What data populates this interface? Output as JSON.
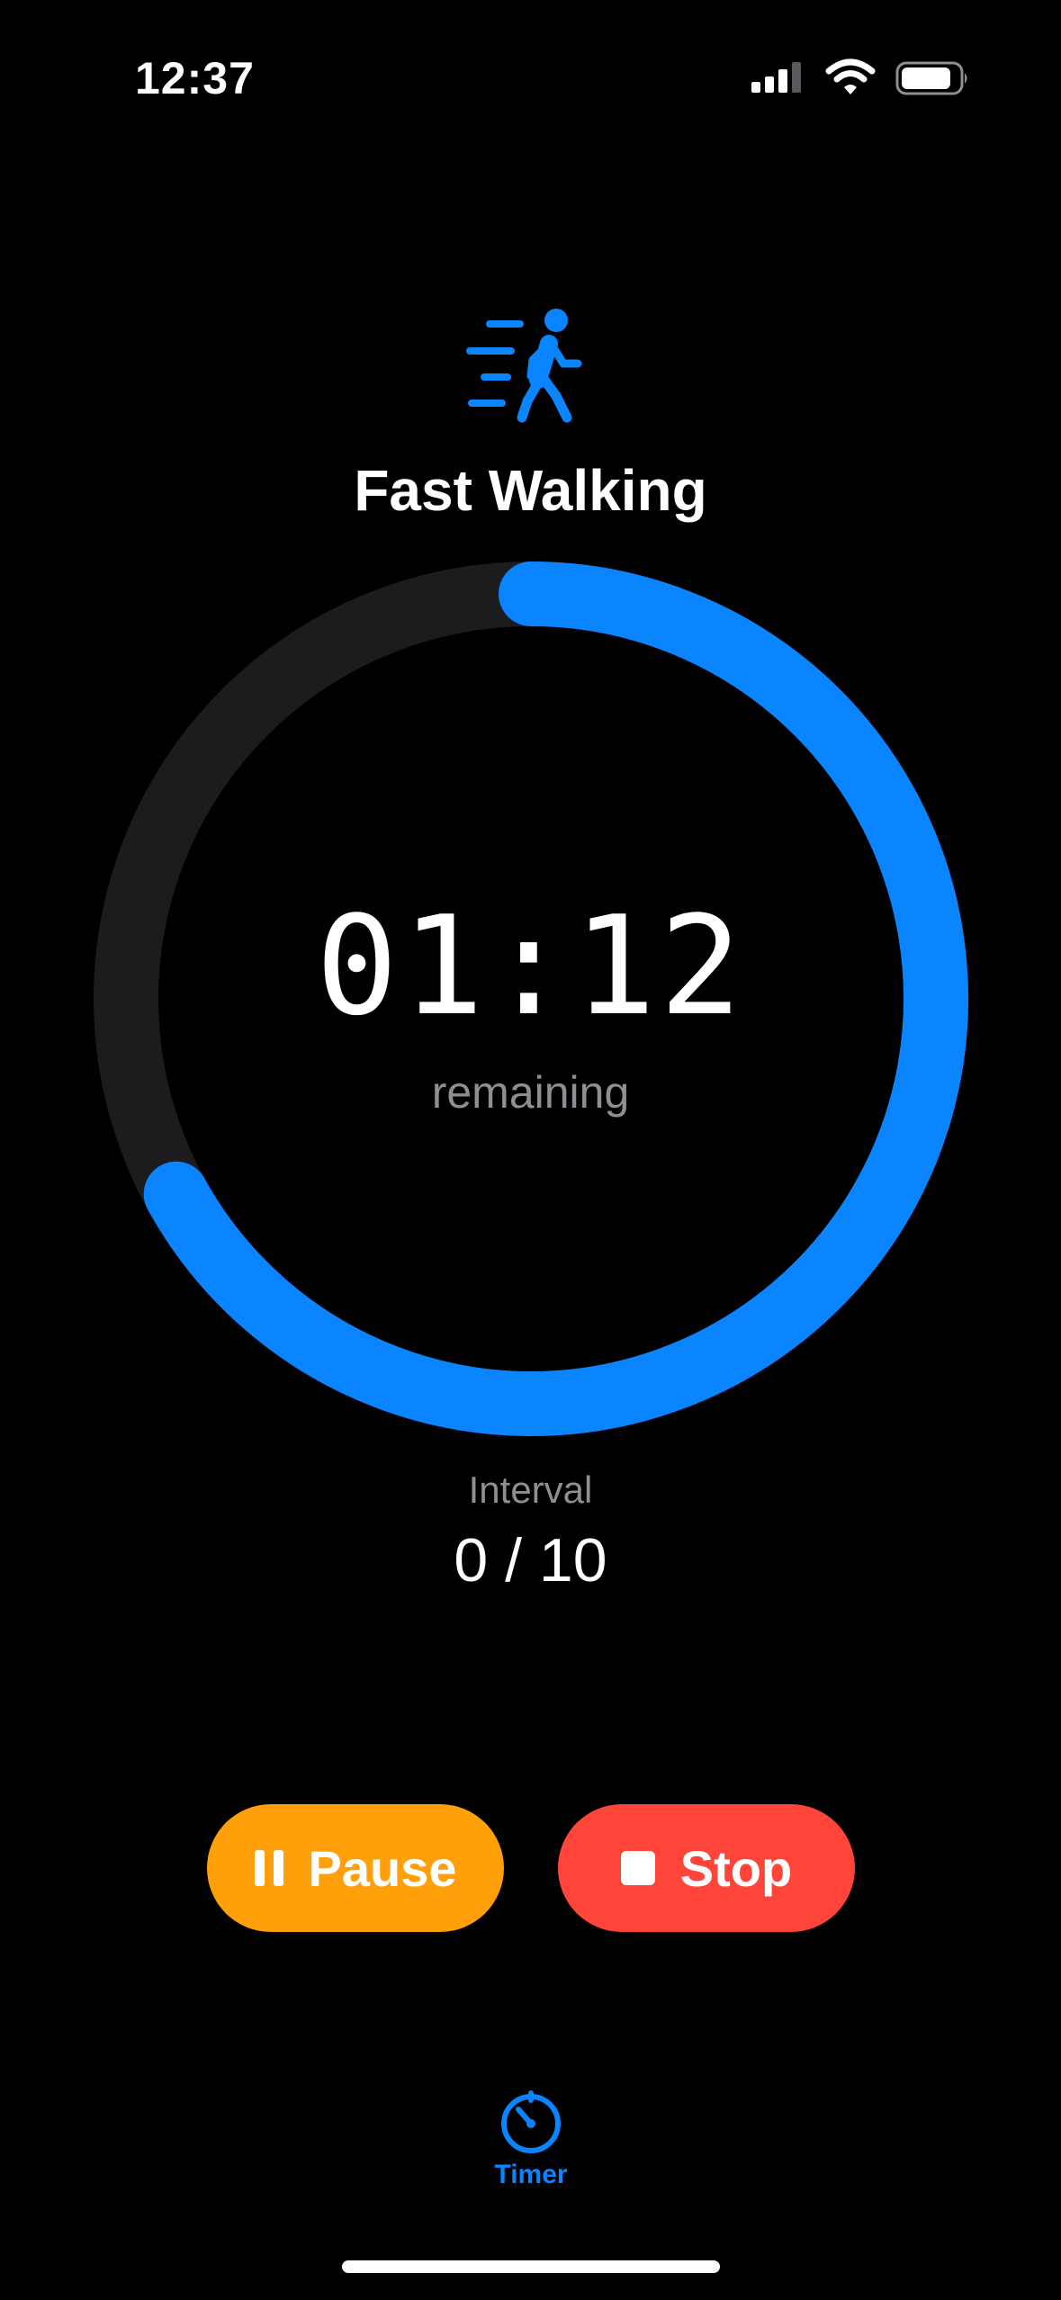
{
  "status_bar": {
    "time": "12:37"
  },
  "activity": {
    "name": "Fast Walking",
    "icon": "figure-walk-motion-icon"
  },
  "timer": {
    "time_remaining": "01:12",
    "remaining_label": "remaining",
    "progress_fraction": 0.67
  },
  "interval": {
    "label": "Interval",
    "value": "0 / 10"
  },
  "controls": {
    "pause_label": "Pause",
    "stop_label": "Stop"
  },
  "tab_bar": {
    "timer_label": "Timer"
  },
  "colors": {
    "accent": "#0a84ff",
    "ring_track": "#1c1c1e",
    "pause": "#ff9f0a",
    "stop": "#ff453a",
    "secondary_text": "#8e8e93"
  }
}
